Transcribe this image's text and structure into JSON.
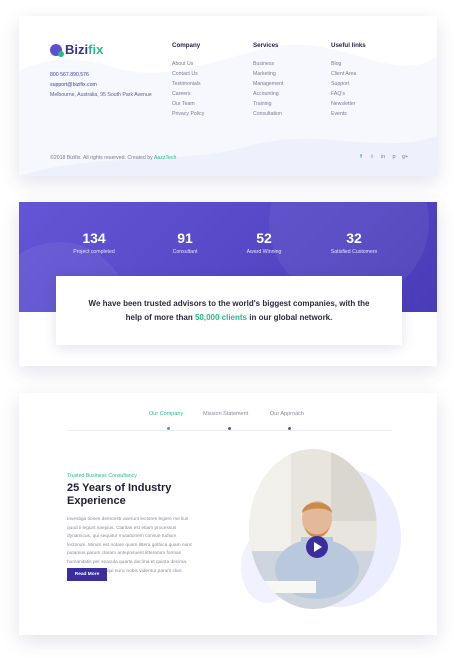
{
  "footer": {
    "logo": {
      "part1": "Bizi",
      "part2": "fix"
    },
    "contact": {
      "phone": "800 567.890.576",
      "email": "support@bizifix.com",
      "address": "Melbourne, Australia, 95 South Park Avenue"
    },
    "columns": [
      {
        "title": "Company",
        "links": [
          "About Us",
          "Contact Us",
          "Testimonials",
          "Careers",
          "Our Team",
          "Privacy Policy"
        ]
      },
      {
        "title": "Services",
        "links": [
          "Business",
          "Marketing",
          "Management",
          "Accounting",
          "Training",
          "Consultation"
        ]
      },
      {
        "title": "Useful links",
        "links": [
          "Blog",
          "Client Area",
          "Support",
          "FAQ's",
          "Newsletter",
          "Events"
        ]
      }
    ],
    "copyright": {
      "text": "©2018 Bizifix. All rights reserved. Created by ",
      "author": "AazzTech"
    },
    "socials": [
      "f",
      "t",
      "in",
      "p",
      "g+"
    ]
  },
  "stats": {
    "items": [
      {
        "value": "134",
        "label": "Project completed"
      },
      {
        "value": "91",
        "label": "Consultant"
      },
      {
        "value": "52",
        "label": "Award Winning"
      },
      {
        "value": "32",
        "label": "Satisfied Customers"
      }
    ],
    "trust": {
      "before": "We have been trusted advisors to the world's biggest companies, with the help of more than ",
      "highlight": "50,000 clients",
      "after": " in our global network."
    },
    "colors": {
      "band": "#5546c8",
      "accent": "#27b98b"
    }
  },
  "about": {
    "tabs": [
      "Our Company",
      "Mission Statement",
      "Our Approach"
    ],
    "active_tab": 0,
    "eyebrow": "Trusted Business Consultancy",
    "headline": "25 Years of Industry Experience",
    "body": "Investiga tiones demonstr averunt lectores legere me lius quod ii legunt saepius. Claritas est etiam processus dynamicus, qui sequitur mutationem consue tudium lectorum. Mirum est notare quam littera gothica quam nunc putamus parum claram anteposuerit litterarum formas humanitatis per seacula quarta decima et quinta decima. Eodem modo typi, qui nunc nobis videntur parum clari, fiant sollemnes in futurum.",
    "body_visible": "Investiga tiones demonstr averunt lectores legere me lius quod ii legunt saepius. Claritas est etiam processus dynamicus, qui sequitur mutationem consue tudium lectorum. Mirum est notare quam littera gothica quam nunc putamus parum claram anteposuerit litterarum formas humanitatis per seacula quarta decima et quinta decima. Eodem modo typi, qui nunc nobis videntur parum clari.",
    "cta": "Read More",
    "icons": {
      "play": "play-icon"
    }
  }
}
